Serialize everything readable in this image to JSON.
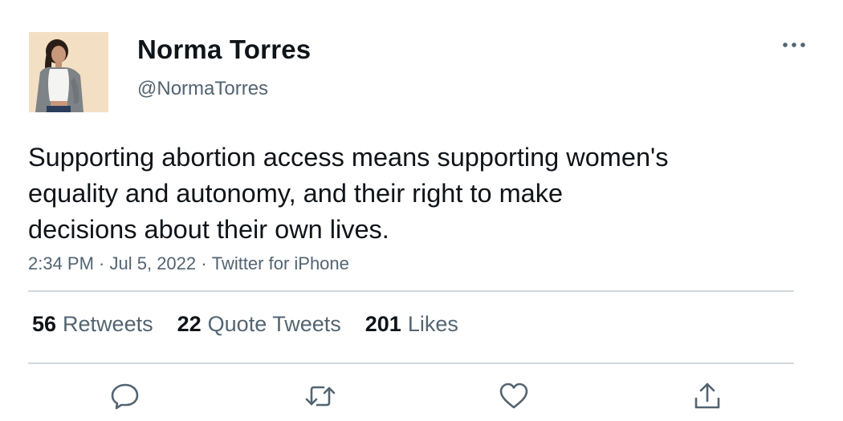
{
  "author": {
    "display_name": "Norma Torres",
    "handle": "@NormaTorres"
  },
  "tweet": {
    "lines": [
      "Supporting abortion access means supporting women's",
      "equality and autonomy, and their right to make",
      "decisions about their own lives."
    ],
    "time": "2:34 PM",
    "date": "Jul 5, 2022",
    "source": "Twitter for iPhone",
    "separator": " · "
  },
  "stats": {
    "retweets": {
      "count": "56",
      "label": "Retweets"
    },
    "quotes": {
      "count": "22",
      "label": "Quote Tweets"
    },
    "likes": {
      "count": "201",
      "label": "Likes"
    }
  },
  "icons": {
    "more": "more-horizontal-icon",
    "reply": "reply-icon",
    "retweet": "retweet-icon",
    "like": "heart-icon",
    "share": "share-icon"
  },
  "colors": {
    "text": "#0f1419",
    "secondary": "#536471",
    "divider": "#cfd9de"
  }
}
